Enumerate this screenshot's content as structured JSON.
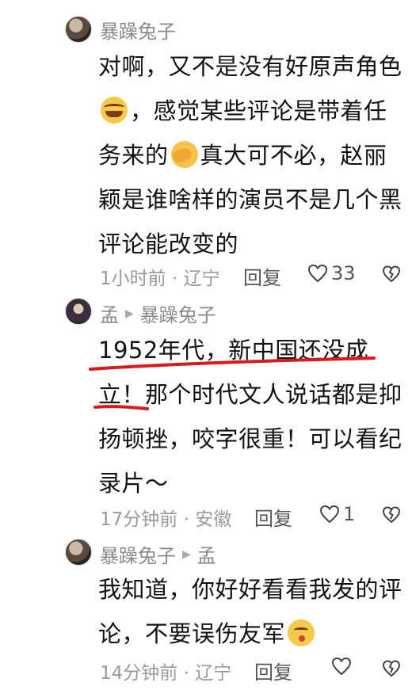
{
  "comments": [
    {
      "author": "暴躁兔子",
      "text_lines": [
        "对啊，又不是没有好原声角色",
        "，感觉某些评论是带着任",
        "务来的",
        "真大可不必，赵丽",
        "颖是谁啥样的演员不是几个黑",
        "评论能改变的"
      ],
      "time": "1小时前",
      "location": "辽宁",
      "reply_label": "回复",
      "likes": "33"
    },
    {
      "author": "孟",
      "reply_to": "暴躁兔子",
      "text_lines": [
        "1952年代，新中国还没成",
        "立！",
        "那个时代文人说话都是抑",
        "扬顿挫，咬字很重！可以看纪",
        "录片～"
      ],
      "time": "17分钟前",
      "location": "安徽",
      "reply_label": "回复",
      "likes": "1"
    },
    {
      "author": "暴躁兔子",
      "reply_to": "孟",
      "text_lines": [
        "我知道，你好好看看我发的评",
        "论，不要误伤友军"
      ],
      "time": "14分钟前",
      "location": "辽宁",
      "reply_label": "回复",
      "likes": ""
    }
  ],
  "separator": " · ",
  "icons": {
    "like": "heart-outline-icon",
    "dislike": "broken-heart-outline-icon",
    "reply_arrow": "triangle-right-icon",
    "emoji_1": "grinning-sweat-emoji",
    "emoji_2": "facepalm-emoji",
    "emoji_3": "kiss-emoji"
  },
  "colors": {
    "annotation_red": "#d91a1a",
    "meta_gray": "#9a9a9a",
    "name_gray": "#8a8a8a"
  }
}
